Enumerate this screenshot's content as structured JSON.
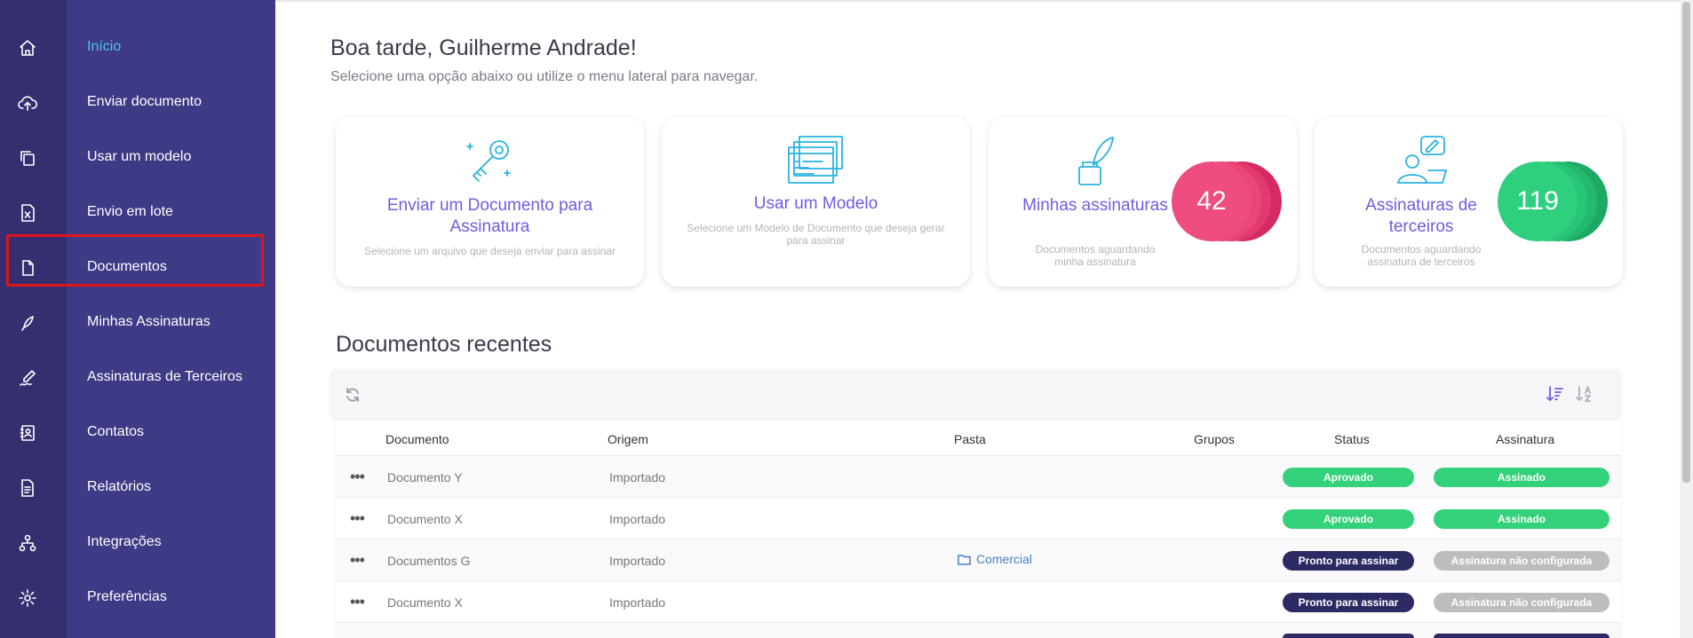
{
  "sidebar": {
    "items": [
      {
        "label": "Início",
        "icon": "home-icon",
        "active": true
      },
      {
        "label": "Enviar documento",
        "icon": "cloud-upload-icon"
      },
      {
        "label": "Usar um modelo",
        "icon": "copy-icon"
      },
      {
        "label": "Envio em lote",
        "icon": "excel-file-icon"
      },
      {
        "label": "Documentos",
        "icon": "document-icon"
      },
      {
        "label": "Minhas Assinaturas",
        "icon": "feather-pen-icon"
      },
      {
        "label": "Assinaturas de Terceiros",
        "icon": "signature-icon"
      },
      {
        "label": "Contatos",
        "icon": "contact-book-icon"
      },
      {
        "label": "Relatórios",
        "icon": "report-icon"
      },
      {
        "label": "Integrações",
        "icon": "network-icon"
      },
      {
        "label": "Preferências",
        "icon": "gear-icon"
      }
    ]
  },
  "header": {
    "greeting": "Boa tarde, Guilherme Andrade!",
    "subtitle": "Selecione uma opção abaixo ou utilize o menu lateral para navegar."
  },
  "cards": [
    {
      "title": "Enviar um Documento para Assinatura",
      "description": "Selecione um arquivo que deseja enviar para assinar",
      "icon": "key-icon"
    },
    {
      "title": "Usar um Modelo",
      "description": "Selecione um Modelo de Documento que deseja gerar para assinar",
      "icon": "template-stack-icon"
    },
    {
      "title": "Minhas assinaturas",
      "description": "Documentos aguardando minha assinatura",
      "icon": "quill-ink-icon",
      "count": "42"
    },
    {
      "title": "Assinaturas de terceiros",
      "description": "Documentos aguardando assinatura de terceiros",
      "icon": "person-signing-icon",
      "count": "119"
    }
  ],
  "recent": {
    "title": "Documentos recentes",
    "columns": [
      "Documento",
      "Origem",
      "Pasta",
      "Grupos",
      "Status",
      "Assinatura"
    ],
    "rows": [
      {
        "documento": "Documento Y",
        "origem": "Importado",
        "pasta": "",
        "grupos": "",
        "status": "Aprovado",
        "assinatura": "Assinado"
      },
      {
        "documento": "Documento X",
        "origem": "Importado",
        "pasta": "",
        "grupos": "",
        "status": "Aprovado",
        "assinatura": "Assinado"
      },
      {
        "documento": "Documentos G",
        "origem": "Importado",
        "pasta": "Comercial",
        "grupos": "",
        "status": "Pronto para assinar",
        "assinatura": "Assinatura não configurada"
      },
      {
        "documento": "Documento X",
        "origem": "Importado",
        "pasta": "",
        "grupos": "",
        "status": "Pronto para assinar",
        "assinatura": "Assinatura não configurada"
      }
    ]
  },
  "colors": {
    "rail": "#352f70",
    "menu": "#3e3a86",
    "accent": "#6f5ce0",
    "active_nav": "#4ec3f0",
    "badge_pink": "#ef4c7f",
    "badge_green": "#2ed07e",
    "approved": "#33d17a",
    "ready": "#2c2a63",
    "not_configured": "#bdbdbd",
    "highlight_box": "#e2141b"
  }
}
